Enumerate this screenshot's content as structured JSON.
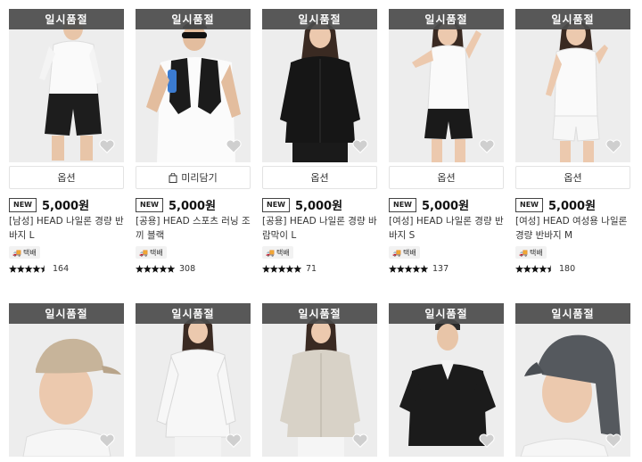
{
  "badge_soldout": "일시품절",
  "new_label": "NEW",
  "ship_label": "택배",
  "row1": [
    {
      "option_label": "옵션",
      "price": "5,000원",
      "name": "[남성] HEAD 나일론 경량 반바지 L",
      "reviews": "164",
      "rating_stars": 4.5
    },
    {
      "option_label": "미리담기",
      "price": "5,000원",
      "name": "[공용] HEAD 스포츠 러닝 조끼 블랙",
      "reviews": "308",
      "rating_stars": 5
    },
    {
      "option_label": "옵션",
      "price": "5,000원",
      "name": "[공용] HEAD 나일론 경량 바람막이 L",
      "reviews": "71",
      "rating_stars": 5
    },
    {
      "option_label": "옵션",
      "price": "5,000원",
      "name": "[여성] HEAD 나일론 경량 반바지 S",
      "reviews": "137",
      "rating_stars": 5
    },
    {
      "option_label": "옵션",
      "price": "5,000원",
      "name": "[여성] HEAD 여성용 나일론 경량 반바지 M",
      "reviews": "180",
      "rating_stars": 4.5
    }
  ],
  "colors": {
    "soldout_bg": "#4b4b4b",
    "star": "#111111",
    "card_bg": "#ededed"
  }
}
